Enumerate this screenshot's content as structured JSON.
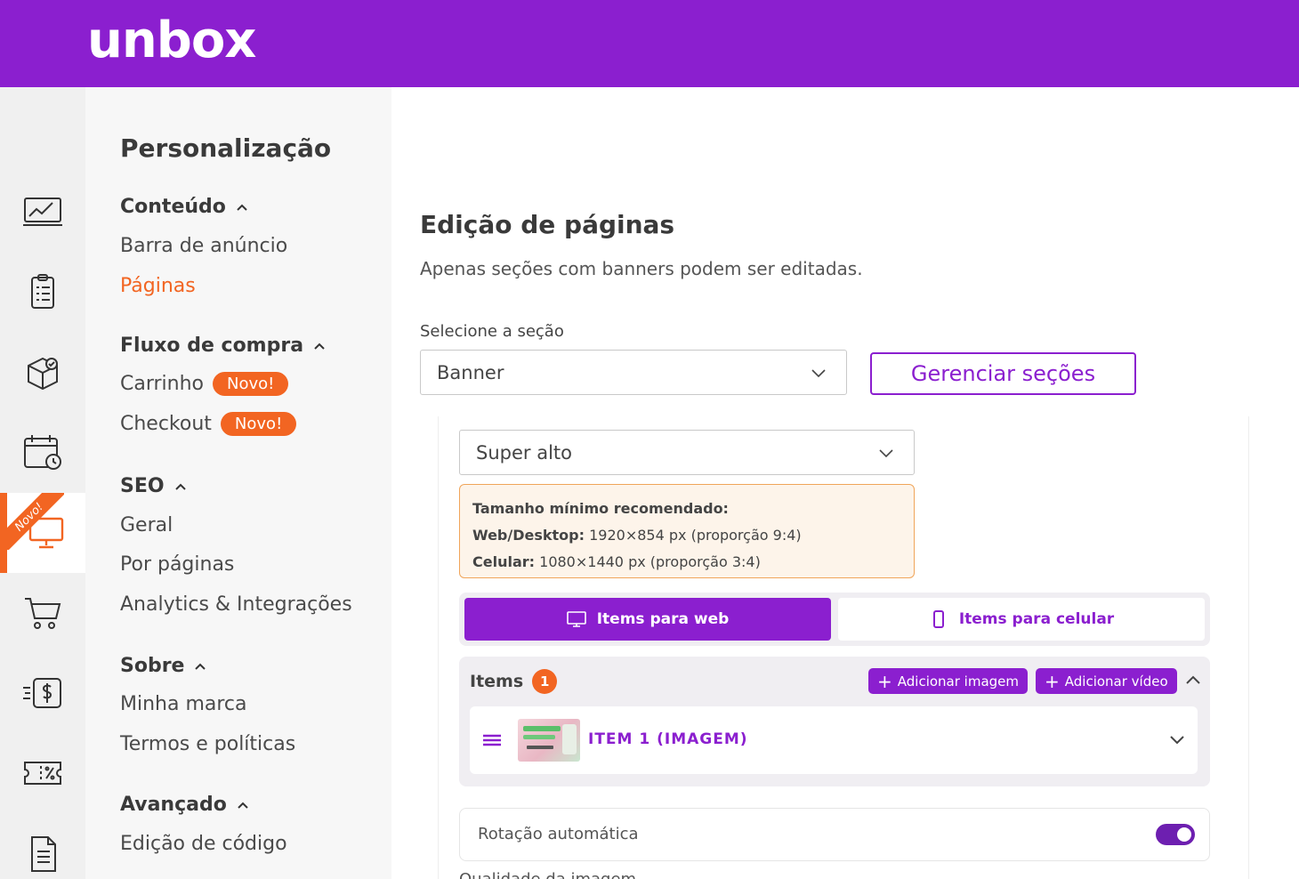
{
  "brand": {
    "name": "unbox",
    "accent": "#8b1fcf",
    "orange": "#f26522"
  },
  "rail": {
    "items": [
      {
        "icon": "dashboard-chart-icon"
      },
      {
        "icon": "orders-clipboard-icon"
      },
      {
        "icon": "products-box-icon"
      },
      {
        "icon": "calendar-clock-icon"
      },
      {
        "icon": "monitor-icon",
        "active": true,
        "ribbon": "Novo!"
      },
      {
        "icon": "cart-icon"
      },
      {
        "icon": "finance-dollar-icon"
      },
      {
        "icon": "coupon-ticket-icon"
      },
      {
        "icon": "document-icon"
      }
    ]
  },
  "nav": {
    "title": "Personalização",
    "sections": [
      {
        "label": "Conteúdo",
        "links": [
          "Barra de anúncio",
          "Páginas"
        ]
      },
      {
        "label": "Fluxo de compra",
        "links": [
          "Carrinho",
          "Checkout"
        ],
        "badge": "Novo!"
      },
      {
        "label": "SEO",
        "links": [
          "Geral",
          "Por páginas",
          "Analytics & Integrações"
        ]
      },
      {
        "label": "Sobre",
        "links": [
          "Minha marca",
          "Termos e políticas"
        ]
      },
      {
        "label": "Avançado",
        "links": [
          "Edição de código"
        ]
      }
    ]
  },
  "main": {
    "title": "Edição de páginas",
    "subtitle": "Apenas seções com banners podem ser editadas.",
    "section_label": "Selecione a seção",
    "section_value": "Banner",
    "manage_button": "Gerenciar seções",
    "height_value": "Super alto",
    "info": {
      "heading": "Tamanho mínimo recomendado:",
      "web_label": "Web/Desktop:",
      "web_value": "1920×854 px (proporção 9:4)",
      "mobile_label": "Celular:",
      "mobile_value": "1080×1440 px (proporção 3:4)"
    },
    "tabs": {
      "web": "Items para web",
      "mobile": "Items para celular"
    },
    "items": {
      "label": "Items",
      "count": "1",
      "add_image": "Adicionar imagem",
      "add_video": "Adicionar vídeo",
      "list": [
        {
          "name": "ITEM 1 (IMAGEM)"
        }
      ]
    },
    "rotation_label": "Rotação automática",
    "rotation_on": true,
    "cut_label": "Qualidade da imagem"
  }
}
